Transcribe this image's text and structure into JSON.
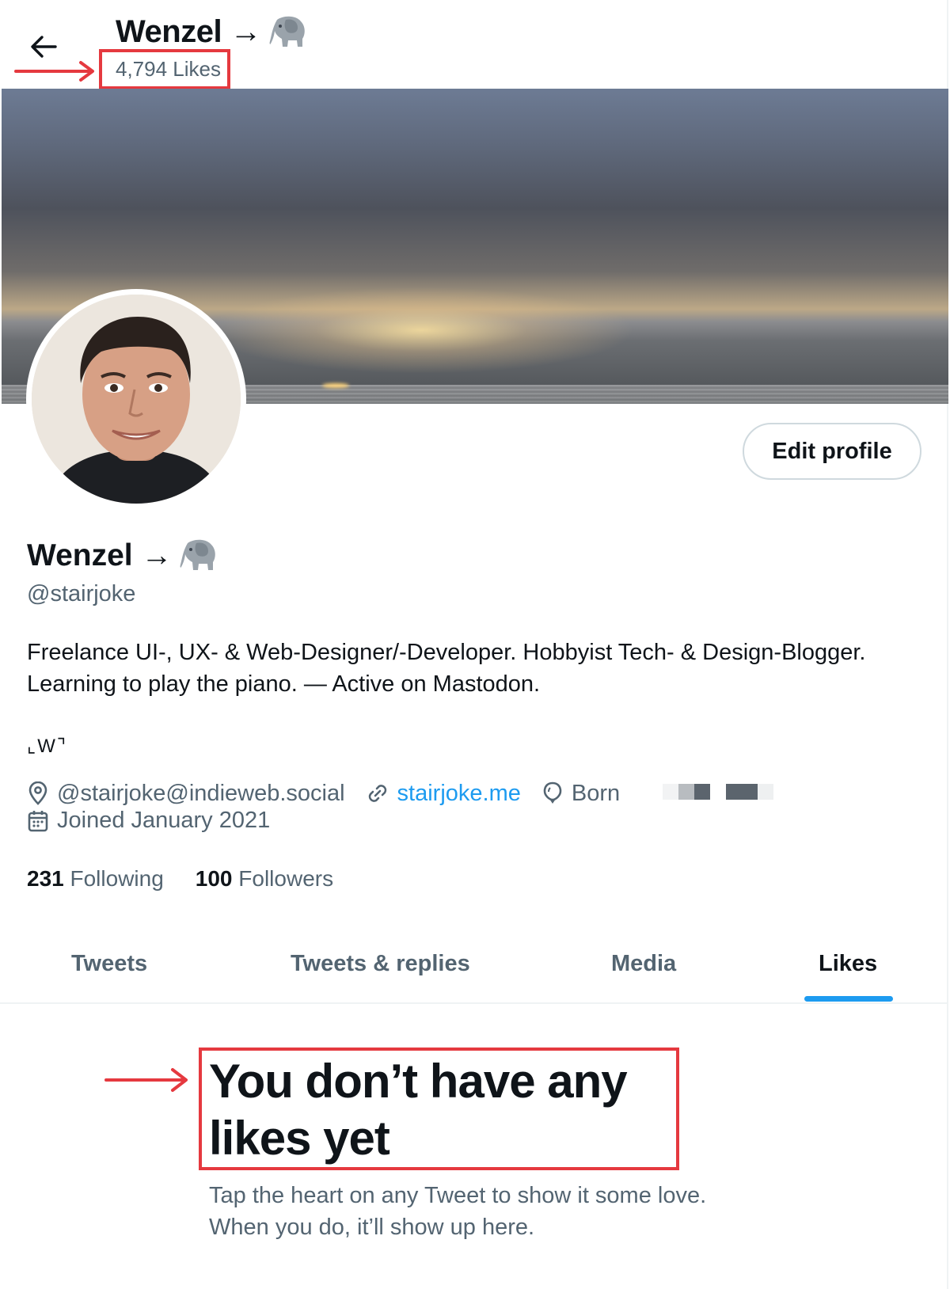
{
  "header": {
    "title": "Wenzel →",
    "likes_count": "4,794 Likes"
  },
  "profile": {
    "edit_button": "Edit profile",
    "display_name": "Wenzel →",
    "handle": "@stairjoke",
    "bio_lines": [
      "Freelance UI-, UX- & Web-Designer/-Developer. Hobbyist Tech- & Design-Blogger.",
      "Learning to play the piano. — Active on Mastodon."
    ],
    "bio_mark": "⌞W⌝",
    "location": "@stairjoke@indieweb.social",
    "website": "stairjoke.me",
    "born_label": "Born",
    "joined": "Joined January 2021",
    "following_count": "231",
    "following_label": "Following",
    "followers_count": "100",
    "followers_label": "Followers"
  },
  "tabs": [
    {
      "label": "Tweets"
    },
    {
      "label": "Tweets & replies"
    },
    {
      "label": "Media"
    },
    {
      "label": "Likes"
    }
  ],
  "active_tab": "Likes",
  "empty_state": {
    "title_lines": [
      "You don’t have any",
      "likes yet"
    ],
    "subtitle_lines": [
      "Tap the heart on any Tweet to show it some love.",
      "When you do, it’ll show up here."
    ]
  },
  "colors": {
    "accent": "#1d9bf0",
    "annotation": "#e5393f",
    "secondary_text": "#536471"
  },
  "icons": [
    "back-arrow-icon",
    "elephant-emoji-icon",
    "location-pin-icon",
    "link-icon",
    "balloon-icon",
    "calendar-icon"
  ]
}
